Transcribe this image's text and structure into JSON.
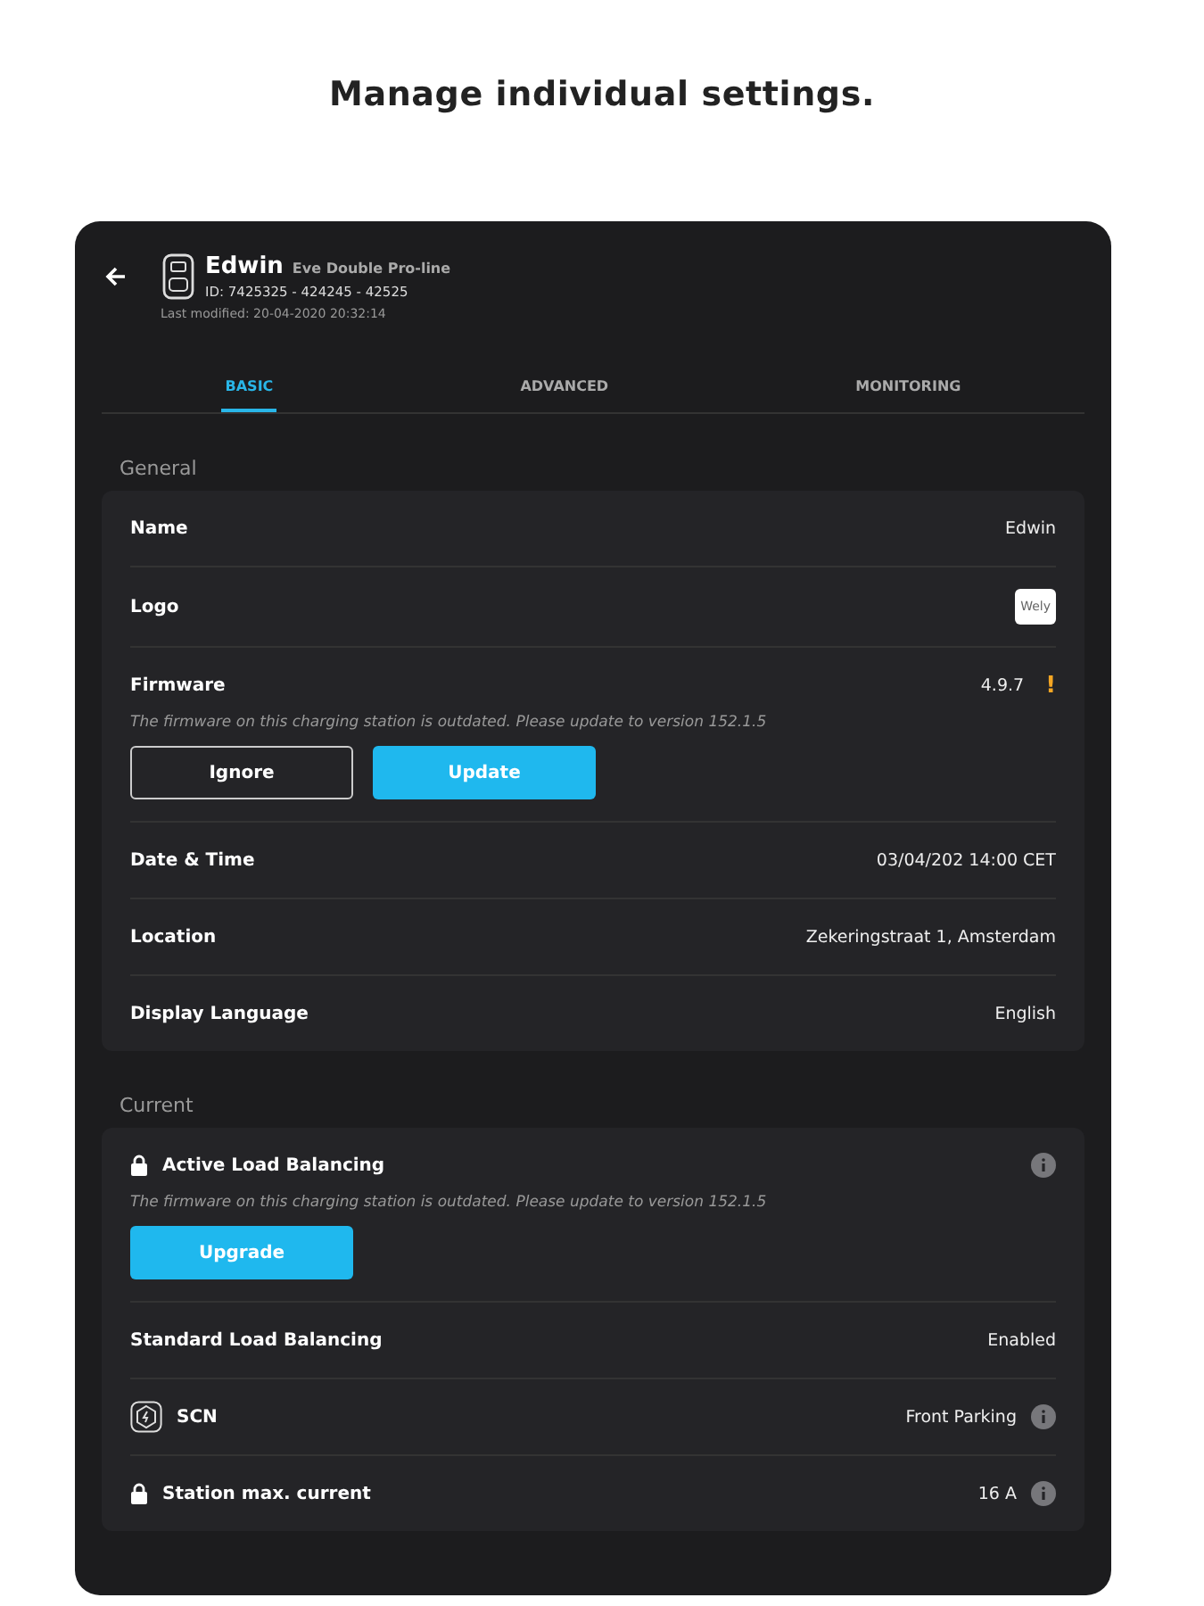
{
  "headline": "Manage individual settings.",
  "device": {
    "name": "Edwin",
    "model": "Eve Double Pro-line",
    "id": "ID: 7425325 - 424245 - 42525",
    "modified": "Last modified: 20-04-2020 20:32:14"
  },
  "tabs": [
    {
      "label": "BASIC",
      "selected": true
    },
    {
      "label": "ADVANCED",
      "selected": false
    },
    {
      "label": "MONITORING",
      "selected": false
    }
  ],
  "sections": [
    {
      "title": "General",
      "rows": [
        {
          "kind": "value",
          "label": "Name",
          "value": "Edwin"
        },
        {
          "kind": "logo",
          "label": "Logo",
          "value": "Wely"
        },
        {
          "kind": "value",
          "label": "Firmware",
          "value": "4.9.7",
          "alert": "!",
          "notice": "The firmware on this charging station is outdated. Please update to version 152.1.5",
          "buttons": [
            {
              "label": "Ignore",
              "kind": "outline"
            },
            {
              "label": "Update",
              "kind": "primary"
            }
          ]
        },
        {
          "kind": "value",
          "label": "Date & Time",
          "value": "03/04/202 14:00 CET"
        },
        {
          "kind": "value",
          "label": "Location",
          "value": "Zekeringstraat 1, Amsterdam"
        },
        {
          "kind": "value",
          "label": "Display Language",
          "value": "English"
        }
      ]
    },
    {
      "title": "Current",
      "rows": [
        {
          "kind": "locked",
          "label": "Active Load Balancing",
          "info": true,
          "notice": "The firmware on this charging station is outdated. Please update to version 152.1.5",
          "buttons": [
            {
              "label": "Upgrade",
              "kind": "primary"
            }
          ]
        },
        {
          "kind": "value",
          "label": "Standard Load Balancing",
          "value": "Enabled"
        },
        {
          "kind": "network",
          "label": "SCN",
          "value": "Front Parking",
          "info": true
        },
        {
          "kind": "locked",
          "label": "Station max. current",
          "value": "16 A",
          "info": true
        }
      ]
    }
  ]
}
